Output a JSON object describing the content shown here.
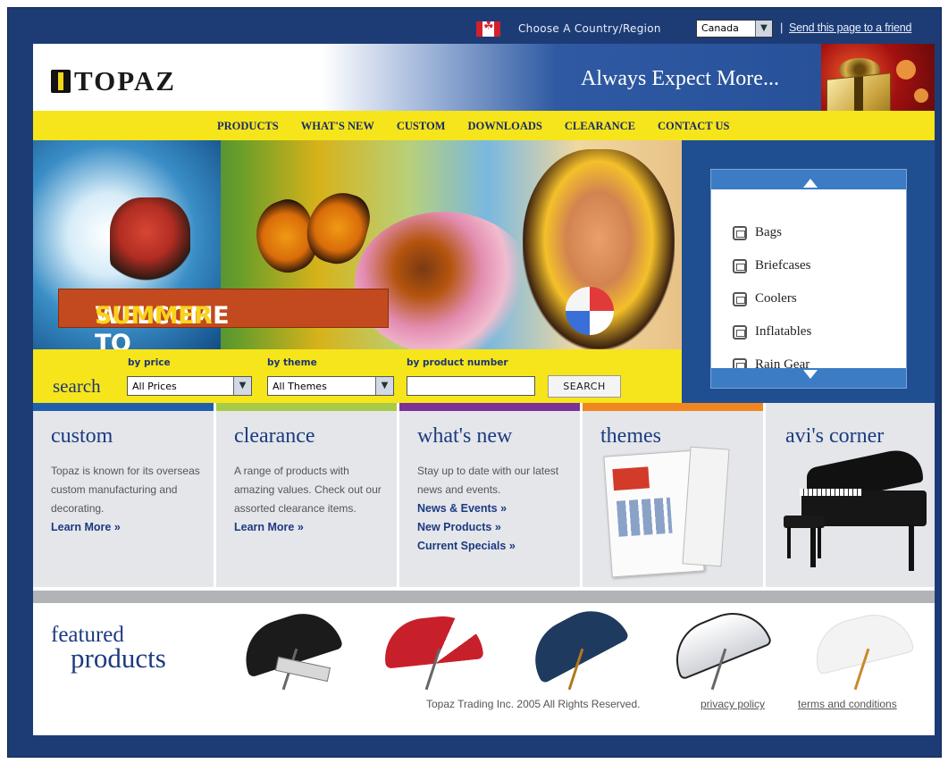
{
  "topbar": {
    "choose_label": "Choose A Country/Region",
    "country_selected": "Canada",
    "separator": "|",
    "send_link": "Send this page to a friend"
  },
  "header": {
    "logo_text": "TOPAZ",
    "tagline": "Always Expect More..."
  },
  "nav": {
    "items": [
      "PRODUCTS",
      "WHAT'S NEW",
      "CUSTOM",
      "DOWNLOADS",
      "CLEARANCE",
      "CONTACT US"
    ]
  },
  "hero": {
    "welcome_white": "WELCOME TO ",
    "welcome_yellow": "SUMMER"
  },
  "categories": {
    "items": [
      "Bags",
      "Briefcases",
      "Coolers",
      "Inflatables",
      "Rain Gear"
    ]
  },
  "search": {
    "title": "search",
    "price_label": "by price",
    "price_value": "All Prices",
    "theme_label": "by theme",
    "theme_value": "All Themes",
    "number_label": "by product number",
    "number_value": "",
    "button_label": "SEARCH"
  },
  "features": {
    "custom": {
      "title": "custom",
      "text": "Topaz is known for its overseas custom manufacturing and decorating.",
      "link": "Learn More »"
    },
    "clearance": {
      "title": "clearance",
      "text": "A range of products with amazing values. Check out our assorted clearance items.",
      "link": "Learn More »"
    },
    "whatsnew": {
      "title": "what's new",
      "text": "Stay up to date with our latest news and events.",
      "links": [
        "News & Events »",
        "New Products »",
        "Current Specials »"
      ]
    },
    "themes": {
      "title": "themes"
    },
    "avis": {
      "title": "avi's corner"
    }
  },
  "featured": {
    "line1": "featured",
    "line2": "products"
  },
  "footer": {
    "copyright": "Topaz Trading Inc. 2005 All Rights Reserved.",
    "privacy": "privacy policy",
    "terms": "terms and conditions"
  },
  "colors": {
    "navy": "#1d3c76",
    "yellow": "#f6e51a",
    "bar_custom": "#1f5fae",
    "bar_clearance": "#a7cb48",
    "bar_whatsnew": "#7b3196",
    "bar_themes": "#ef8620"
  }
}
